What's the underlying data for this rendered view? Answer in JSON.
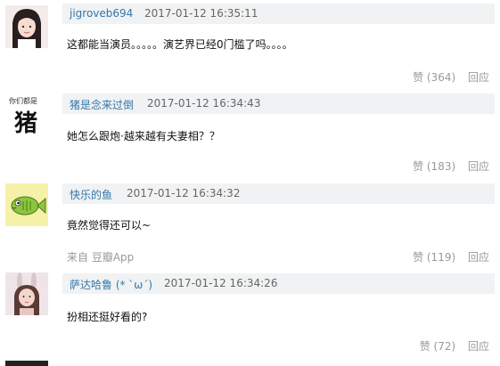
{
  "comments": [
    {
      "username": "jigroveb694",
      "time": "2017-01-12 16:35:11",
      "text": "这都能当演员。。。。。演艺界已经0门槛了吗。。。。",
      "likes": "赞 (364)",
      "reply": "回应",
      "avatar": "girl-photo"
    },
    {
      "username": "猪是念来过倒",
      "time": "2017-01-12 16:34:43",
      "text": "她怎么跟炮·越来越有夫妻相？？",
      "likes": "赞 (183)",
      "reply": "回应",
      "avatar": "pig-character",
      "avatar_small_text": "你们都是",
      "avatar_big_text": "猪"
    },
    {
      "username": "快乐的鱼",
      "time": "2017-01-12 16:34:32",
      "text": "竟然觉得还可以~",
      "source": "来自 豆瓣App",
      "likes": "赞 (119)",
      "reply": "回应",
      "avatar": "cartoon-fish"
    },
    {
      "username": "萨达哈鲁 (* `ω´)",
      "time": "2017-01-12 16:34:26",
      "text": "扮相还挺好看的?",
      "likes": "赞 (72)",
      "reply": "回应",
      "avatar": "bunny-girl"
    }
  ],
  "colors": {
    "header_bg": "#f0f2f3",
    "username": "#3377aa",
    "meta": "#999999"
  }
}
